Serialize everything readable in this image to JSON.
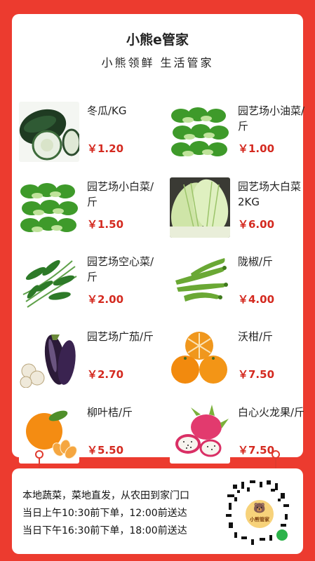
{
  "header": {
    "title": "小熊e管家",
    "subtitle": "小熊领鲜 生活管家"
  },
  "products": [
    {
      "name": "冬瓜/KG",
      "price": "￥1.20",
      "icon": "winter-melon-icon"
    },
    {
      "name": "园艺场小油菜/斤",
      "price": "￥1.00",
      "icon": "bok-choy-icon"
    },
    {
      "name": "园艺场小白菜/斤",
      "price": "￥1.50",
      "icon": "bok-choy-icon"
    },
    {
      "name": "园艺场大白菜2KG",
      "price": "￥6.00",
      "icon": "napa-cabbage-icon"
    },
    {
      "name": "园艺场空心菜/斤",
      "price": "￥2.00",
      "icon": "water-spinach-icon"
    },
    {
      "name": "陇椒/斤",
      "price": "￥4.00",
      "icon": "green-pepper-icon"
    },
    {
      "name": "园艺场广茄/斤",
      "price": "￥2.70",
      "icon": "eggplant-icon"
    },
    {
      "name": "沃柑/斤",
      "price": "￥7.50",
      "icon": "mandarin-icon"
    },
    {
      "name": "柳叶桔/斤",
      "price": "￥5.50",
      "icon": "tangerine-icon"
    },
    {
      "name": "白心火龙果/斤",
      "price": "￥7.50",
      "icon": "dragon-fruit-icon"
    }
  ],
  "footer": {
    "line1": "本地蔬菜，菜地直发，从农田到家门口",
    "line2": "当日上午10:30前下单，12:00前送达",
    "line3": "当日下午16:30前下单，18:00前送达",
    "qr_label": "小熊管家"
  },
  "colors": {
    "background": "#ec3b2f",
    "price": "#d42a20"
  }
}
